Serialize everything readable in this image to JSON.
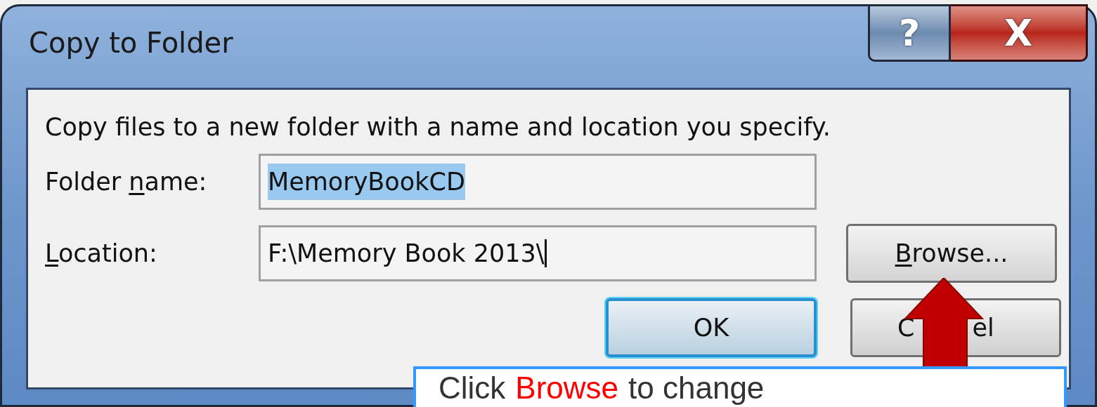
{
  "window": {
    "title": "Copy to Folder",
    "help_button": "?",
    "close_button": "X"
  },
  "dialog": {
    "intro": "Copy files to a new folder with a name and location you specify.",
    "fields": [
      {
        "label": {
          "before": "Folder ",
          "key": "n",
          "after": "ame:"
        },
        "value": "MemoryBookCD",
        "selected": true,
        "caret": false
      },
      {
        "label": {
          "key": "L",
          "after": "ocation:"
        },
        "value": "F:\\Memory Book 2013\\",
        "selected": false,
        "caret": true
      }
    ],
    "browse_button": {
      "key": "B",
      "after": "rowse..."
    },
    "buttons": [
      {
        "label": "OK",
        "default": true
      },
      {
        "label": "C",
        "label_end": "el",
        "default": false
      }
    ]
  },
  "callout": {
    "before": "Click",
    "highlight": "Browse",
    "after": "to change"
  }
}
